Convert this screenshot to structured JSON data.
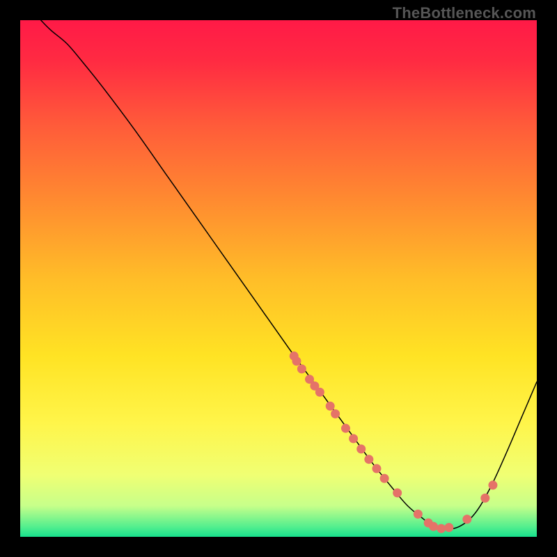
{
  "watermark": "TheBottleneck.com",
  "chart_data": {
    "type": "line",
    "title": "",
    "xlabel": "",
    "ylabel": "",
    "xlim": [
      0,
      100
    ],
    "ylim": [
      0,
      100
    ],
    "grid": false,
    "legend": false,
    "gradient_stops": [
      {
        "offset": 0.0,
        "color": "#ff1a47"
      },
      {
        "offset": 0.08,
        "color": "#ff2b42"
      },
      {
        "offset": 0.2,
        "color": "#ff5a3a"
      },
      {
        "offset": 0.35,
        "color": "#ff8b30"
      },
      {
        "offset": 0.5,
        "color": "#ffbd28"
      },
      {
        "offset": 0.65,
        "color": "#ffe324"
      },
      {
        "offset": 0.78,
        "color": "#fff54a"
      },
      {
        "offset": 0.88,
        "color": "#f0ff73"
      },
      {
        "offset": 0.94,
        "color": "#c7ff8a"
      },
      {
        "offset": 0.98,
        "color": "#55ef8e"
      },
      {
        "offset": 1.0,
        "color": "#17e18d"
      }
    ],
    "series": [
      {
        "name": "bottleneck-curve",
        "type": "line",
        "color": "#000000",
        "width": 1.5,
        "x": [
          4.0,
          6.0,
          9.0,
          12.0,
          16.0,
          22.0,
          28.0,
          34.0,
          40.0,
          46.0,
          52.0,
          56.0,
          60.0,
          64.0,
          68.0,
          72.0,
          75.0,
          78.0,
          80.0,
          82.0,
          85.0,
          88.0,
          91.0,
          94.0,
          97.0,
          100.0
        ],
        "y": [
          100.0,
          98.0,
          95.5,
          92.0,
          87.0,
          79.0,
          70.5,
          62.0,
          53.5,
          45.0,
          36.5,
          31.0,
          25.5,
          20.0,
          14.5,
          9.5,
          6.0,
          3.5,
          2.0,
          1.5,
          2.0,
          4.5,
          9.5,
          16.0,
          23.0,
          30.0
        ],
        "smoothing": 0.18
      },
      {
        "name": "curve-sample-dots",
        "type": "scatter",
        "color": "#e57368",
        "radius": 6.5,
        "x": [
          53.0,
          53.5,
          54.5,
          56.0,
          57.0,
          58.0,
          60.0,
          61.0,
          63.0,
          64.5,
          66.0,
          67.5,
          69.0,
          70.5,
          73.0,
          77.0,
          79.0,
          80.0,
          81.5,
          83.0,
          86.5,
          90.0,
          91.5
        ],
        "y": [
          35.0,
          34.0,
          32.5,
          30.5,
          29.2,
          28.0,
          25.3,
          23.8,
          21.0,
          19.0,
          17.0,
          15.0,
          13.2,
          11.3,
          8.5,
          4.4,
          2.7,
          2.0,
          1.6,
          1.8,
          3.4,
          7.5,
          10.0
        ]
      }
    ]
  }
}
